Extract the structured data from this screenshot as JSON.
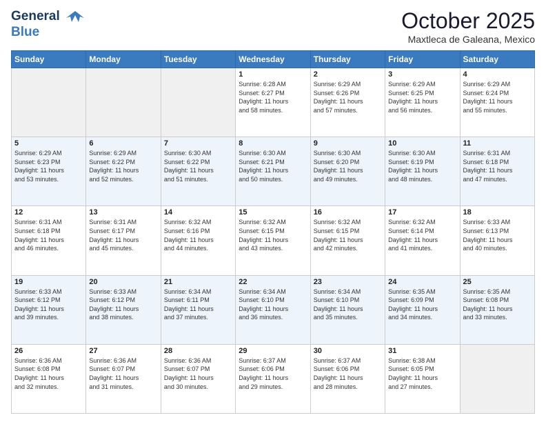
{
  "header": {
    "logo_line1": "General",
    "logo_line2": "Blue",
    "month": "October 2025",
    "location": "Maxtleca de Galeana, Mexico"
  },
  "days_of_week": [
    "Sunday",
    "Monday",
    "Tuesday",
    "Wednesday",
    "Thursday",
    "Friday",
    "Saturday"
  ],
  "weeks": [
    [
      {
        "day": "",
        "info": ""
      },
      {
        "day": "",
        "info": ""
      },
      {
        "day": "",
        "info": ""
      },
      {
        "day": "1",
        "info": "Sunrise: 6:28 AM\nSunset: 6:27 PM\nDaylight: 11 hours\nand 58 minutes."
      },
      {
        "day": "2",
        "info": "Sunrise: 6:29 AM\nSunset: 6:26 PM\nDaylight: 11 hours\nand 57 minutes."
      },
      {
        "day": "3",
        "info": "Sunrise: 6:29 AM\nSunset: 6:25 PM\nDaylight: 11 hours\nand 56 minutes."
      },
      {
        "day": "4",
        "info": "Sunrise: 6:29 AM\nSunset: 6:24 PM\nDaylight: 11 hours\nand 55 minutes."
      }
    ],
    [
      {
        "day": "5",
        "info": "Sunrise: 6:29 AM\nSunset: 6:23 PM\nDaylight: 11 hours\nand 53 minutes."
      },
      {
        "day": "6",
        "info": "Sunrise: 6:29 AM\nSunset: 6:22 PM\nDaylight: 11 hours\nand 52 minutes."
      },
      {
        "day": "7",
        "info": "Sunrise: 6:30 AM\nSunset: 6:22 PM\nDaylight: 11 hours\nand 51 minutes."
      },
      {
        "day": "8",
        "info": "Sunrise: 6:30 AM\nSunset: 6:21 PM\nDaylight: 11 hours\nand 50 minutes."
      },
      {
        "day": "9",
        "info": "Sunrise: 6:30 AM\nSunset: 6:20 PM\nDaylight: 11 hours\nand 49 minutes."
      },
      {
        "day": "10",
        "info": "Sunrise: 6:30 AM\nSunset: 6:19 PM\nDaylight: 11 hours\nand 48 minutes."
      },
      {
        "day": "11",
        "info": "Sunrise: 6:31 AM\nSunset: 6:18 PM\nDaylight: 11 hours\nand 47 minutes."
      }
    ],
    [
      {
        "day": "12",
        "info": "Sunrise: 6:31 AM\nSunset: 6:18 PM\nDaylight: 11 hours\nand 46 minutes."
      },
      {
        "day": "13",
        "info": "Sunrise: 6:31 AM\nSunset: 6:17 PM\nDaylight: 11 hours\nand 45 minutes."
      },
      {
        "day": "14",
        "info": "Sunrise: 6:32 AM\nSunset: 6:16 PM\nDaylight: 11 hours\nand 44 minutes."
      },
      {
        "day": "15",
        "info": "Sunrise: 6:32 AM\nSunset: 6:15 PM\nDaylight: 11 hours\nand 43 minutes."
      },
      {
        "day": "16",
        "info": "Sunrise: 6:32 AM\nSunset: 6:15 PM\nDaylight: 11 hours\nand 42 minutes."
      },
      {
        "day": "17",
        "info": "Sunrise: 6:32 AM\nSunset: 6:14 PM\nDaylight: 11 hours\nand 41 minutes."
      },
      {
        "day": "18",
        "info": "Sunrise: 6:33 AM\nSunset: 6:13 PM\nDaylight: 11 hours\nand 40 minutes."
      }
    ],
    [
      {
        "day": "19",
        "info": "Sunrise: 6:33 AM\nSunset: 6:12 PM\nDaylight: 11 hours\nand 39 minutes."
      },
      {
        "day": "20",
        "info": "Sunrise: 6:33 AM\nSunset: 6:12 PM\nDaylight: 11 hours\nand 38 minutes."
      },
      {
        "day": "21",
        "info": "Sunrise: 6:34 AM\nSunset: 6:11 PM\nDaylight: 11 hours\nand 37 minutes."
      },
      {
        "day": "22",
        "info": "Sunrise: 6:34 AM\nSunset: 6:10 PM\nDaylight: 11 hours\nand 36 minutes."
      },
      {
        "day": "23",
        "info": "Sunrise: 6:34 AM\nSunset: 6:10 PM\nDaylight: 11 hours\nand 35 minutes."
      },
      {
        "day": "24",
        "info": "Sunrise: 6:35 AM\nSunset: 6:09 PM\nDaylight: 11 hours\nand 34 minutes."
      },
      {
        "day": "25",
        "info": "Sunrise: 6:35 AM\nSunset: 6:08 PM\nDaylight: 11 hours\nand 33 minutes."
      }
    ],
    [
      {
        "day": "26",
        "info": "Sunrise: 6:36 AM\nSunset: 6:08 PM\nDaylight: 11 hours\nand 32 minutes."
      },
      {
        "day": "27",
        "info": "Sunrise: 6:36 AM\nSunset: 6:07 PM\nDaylight: 11 hours\nand 31 minutes."
      },
      {
        "day": "28",
        "info": "Sunrise: 6:36 AM\nSunset: 6:07 PM\nDaylight: 11 hours\nand 30 minutes."
      },
      {
        "day": "29",
        "info": "Sunrise: 6:37 AM\nSunset: 6:06 PM\nDaylight: 11 hours\nand 29 minutes."
      },
      {
        "day": "30",
        "info": "Sunrise: 6:37 AM\nSunset: 6:06 PM\nDaylight: 11 hours\nand 28 minutes."
      },
      {
        "day": "31",
        "info": "Sunrise: 6:38 AM\nSunset: 6:05 PM\nDaylight: 11 hours\nand 27 minutes."
      },
      {
        "day": "",
        "info": ""
      }
    ]
  ]
}
